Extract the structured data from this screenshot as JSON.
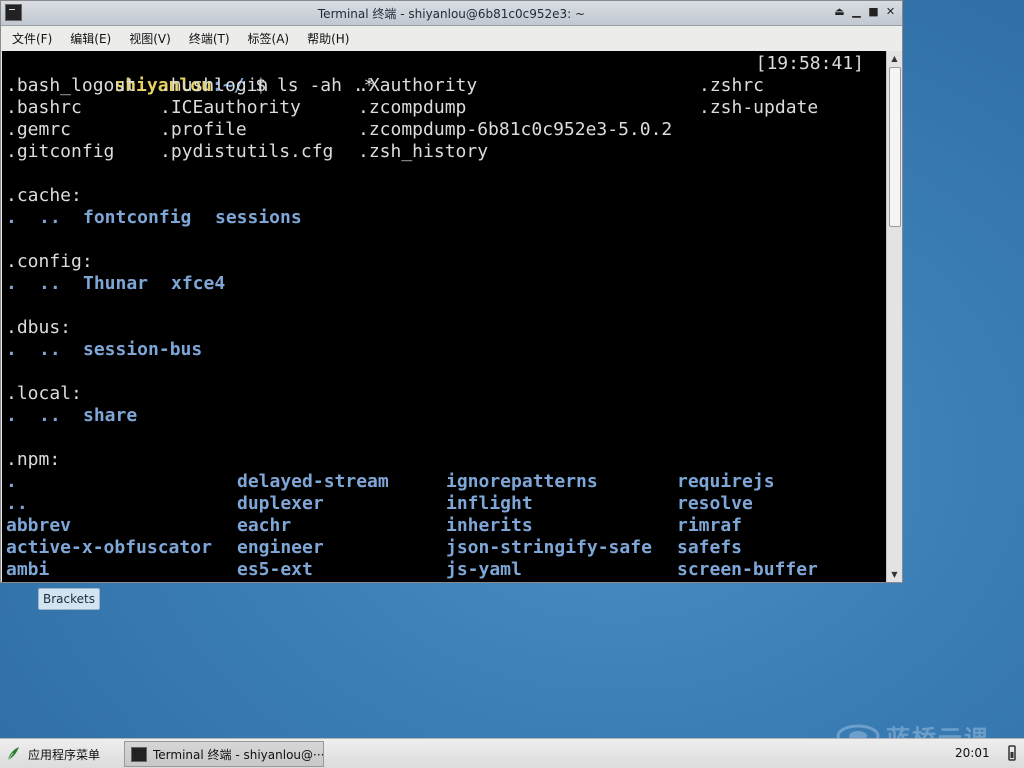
{
  "window": {
    "title": "Terminal 终端 - shiyanlou@6b81c0c952e3: ~",
    "controls": [
      "⏏",
      "▁",
      "■",
      "✕"
    ]
  },
  "menubar": {
    "items": [
      "文件(F)",
      "编辑(E)",
      "视图(V)",
      "终端(T)",
      "标签(A)",
      "帮助(H)"
    ]
  },
  "terminal": {
    "prompt_user": "shiyanlou",
    "prompt_path": ":~/",
    "prompt_symbol": " $ ",
    "command": "ls -ah .*",
    "timestamp": "[19:58:41]",
    "files_rows": [
      [
        ".bash_logout",
        ".hushlogin",
        ".Xauthority",
        ".zshrc"
      ],
      [
        ".bashrc",
        ".ICEauthority",
        ".zcompdump",
        ".zsh-update"
      ],
      [
        ".gemrc",
        ".profile",
        ".zcompdump-6b81c0c952e3-5.0.2",
        ""
      ],
      [
        ".gitconfig",
        ".pydistutils.cfg",
        ".zsh_history",
        ""
      ]
    ],
    "sections": [
      {
        "header": ".cache:",
        "entries": [
          ".",
          "..",
          "fontconfig",
          "sessions"
        ]
      },
      {
        "header": ".config:",
        "entries": [
          ".",
          "..",
          "Thunar",
          "xfce4"
        ]
      },
      {
        "header": ".dbus:",
        "entries": [
          ".",
          "..",
          "session-bus"
        ]
      },
      {
        "header": ".local:",
        "entries": [
          ".",
          "..",
          "share"
        ]
      }
    ],
    "npm": {
      "header": ".npm:",
      "rows": [
        [
          ".",
          "delayed-stream",
          "ignorepatterns",
          "requirejs"
        ],
        [
          "..",
          "duplexer",
          "inflight",
          "resolve"
        ],
        [
          "abbrev",
          "eachr",
          "inherits",
          "rimraf"
        ],
        [
          "active-x-obfuscator",
          "engineer",
          "json-stringify-safe",
          "safefs"
        ],
        [
          "ambi",
          "es5-ext",
          "js-yaml",
          "screen-buffer"
        ]
      ]
    }
  },
  "desktop": {
    "icon_label": "Brackets"
  },
  "watermark": {
    "text": "蓝桥云课"
  },
  "taskbar": {
    "start_label": "应用程序菜单",
    "task_label": "Terminal 终端 - shiyanlou@···",
    "clock": "20:01"
  }
}
